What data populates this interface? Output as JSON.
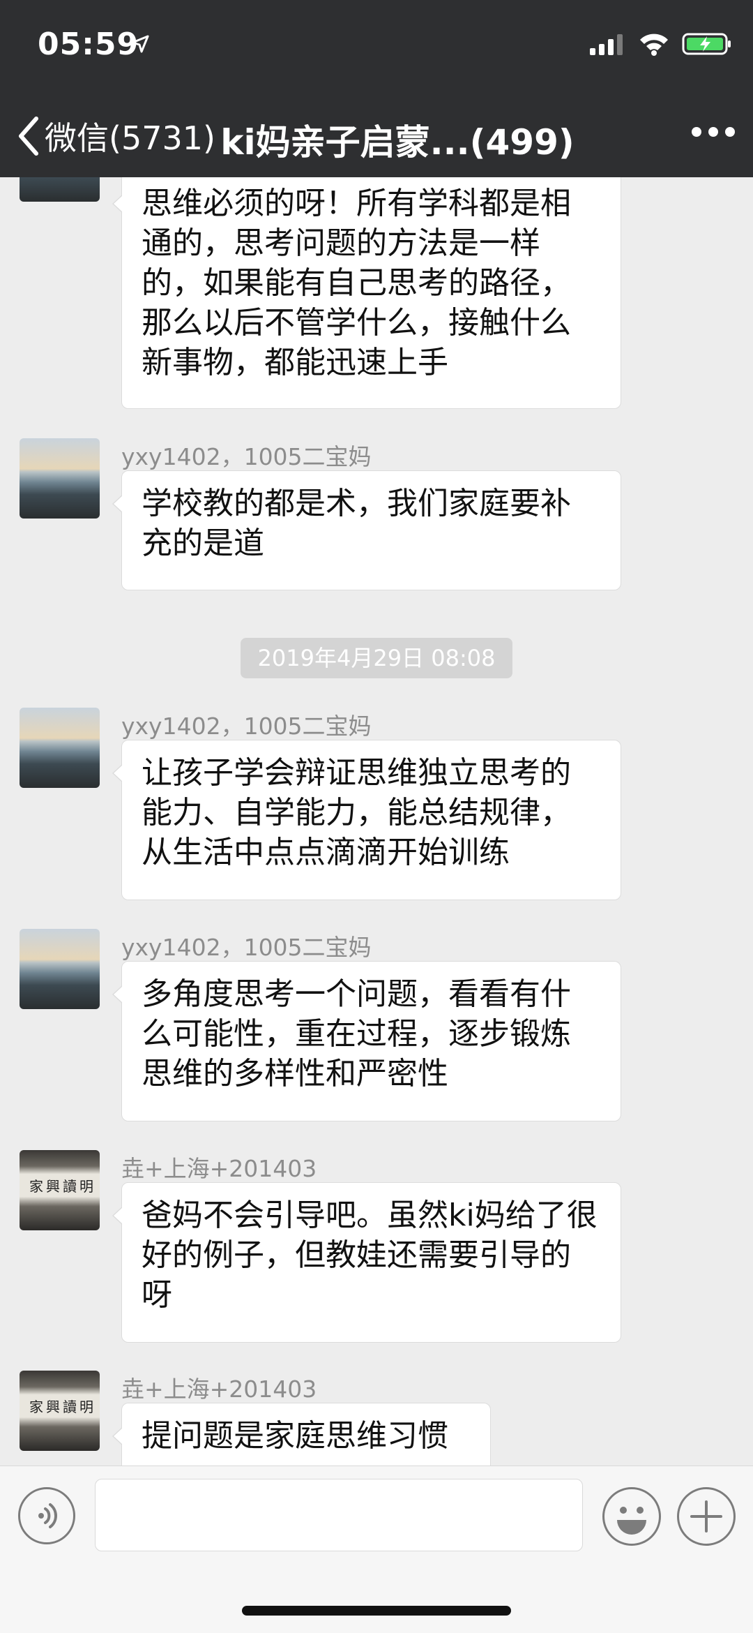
{
  "status_bar": {
    "time": "05:59"
  },
  "nav": {
    "back_label": "微信(5731)",
    "title": "ki妈亲子启蒙...(499)"
  },
  "messages": [
    {
      "sender": "",
      "text": "思维必须的呀！所有学科都是相通的，思考问题的方法是一样的，如果能有自己思考的路径，那么以后不管学什么，接触什么新事物，都能迅速上手"
    },
    {
      "sender": "yxy1402，1005二宝妈",
      "text": "学校教的都是术，我们家庭要补充的是道"
    },
    {
      "sender": "yxy1402，1005二宝妈",
      "text": "让孩子学会辩证思维独立思考的能力、自学能力，能总结规律，从生活中点点滴滴开始训练"
    },
    {
      "sender": "yxy1402，1005二宝妈",
      "text": "多角度思考一个问题，看看有什么可能性，重在过程，逐步锻炼思维的多样性和严密性"
    },
    {
      "sender": "垚+上海+201403",
      "text": "爸妈不会引导吧。虽然ki妈给了很好的例子，但教娃还需要引导的呀"
    },
    {
      "sender": "垚+上海+201403",
      "text": "提问题是家庭思维习惯"
    }
  ],
  "timestamp": "2019年4月29日 08:08",
  "avatar_sign_text": "家興讀明",
  "icons": {
    "back": "chevron-left-icon",
    "more": "more-dots-icon",
    "voice": "voice-icon",
    "emoji": "emoji-icon",
    "plus": "plus-icon"
  },
  "colors": {
    "nav_bg": "#2e2f31",
    "chat_bg": "#ededed",
    "battery": "#4cd964"
  }
}
